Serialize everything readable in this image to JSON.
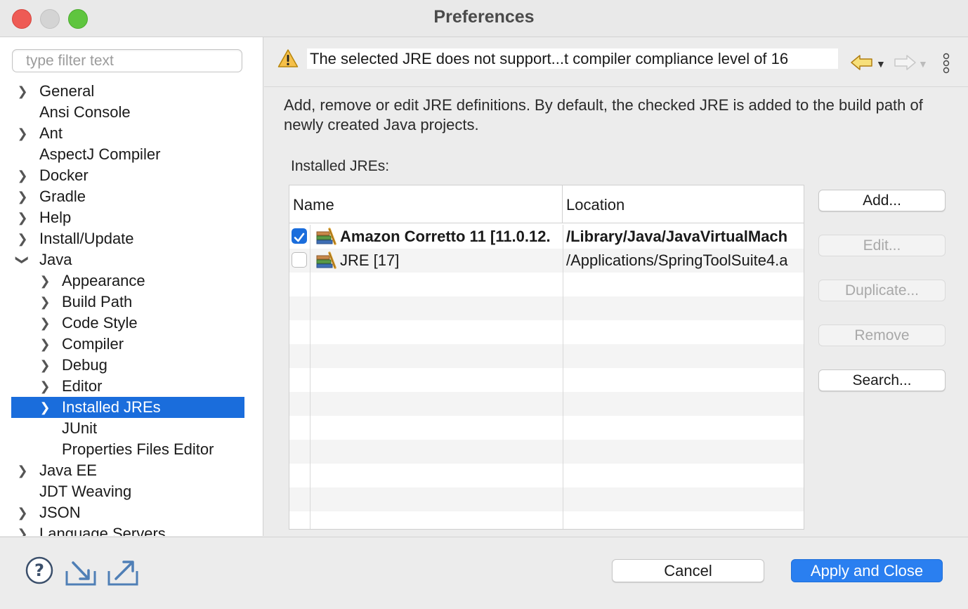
{
  "window": {
    "title": "Preferences"
  },
  "filter": {
    "placeholder": "type filter text"
  },
  "tree": {
    "general": "General",
    "ansi_console": "Ansi Console",
    "ant": "Ant",
    "aspectj": "AspectJ Compiler",
    "docker": "Docker",
    "gradle": "Gradle",
    "help": "Help",
    "install_update": "Install/Update",
    "java": "Java",
    "appearance": "Appearance",
    "build_path": "Build Path",
    "code_style": "Code Style",
    "compiler": "Compiler",
    "debug": "Debug",
    "editor": "Editor",
    "installed_jres": "Installed JREs",
    "junit": "JUnit",
    "properties_files_editor": "Properties Files Editor",
    "java_ee": "Java EE",
    "jdt_weaving": "JDT Weaving",
    "json": "JSON",
    "language_servers": "Language Servers"
  },
  "message": {
    "text": "The selected JRE does not support...t compiler compliance level of 16"
  },
  "page": {
    "description": "Add, remove or edit JRE definitions. By default, the checked JRE is added to the build path of newly created Java projects.",
    "installed_label": "Installed JREs:"
  },
  "table": {
    "col_name": "Name",
    "col_location": "Location",
    "rows": [
      {
        "name": "Amazon Corretto 11 [11.0.12.",
        "location": "/Library/Java/JavaVirtualMach",
        "checked": true
      },
      {
        "name": "JRE [17]",
        "location": "/Applications/SpringToolSuite4.a",
        "checked": false
      }
    ]
  },
  "buttons": {
    "add": "Add...",
    "edit": "Edit...",
    "duplicate": "Duplicate...",
    "remove": "Remove",
    "search": "Search...",
    "cancel": "Cancel",
    "apply_close": "Apply and Close"
  },
  "colors": {
    "accent": "#1a6ddc",
    "primary_button": "#2a7ff0",
    "warning": "#f5c04a"
  }
}
